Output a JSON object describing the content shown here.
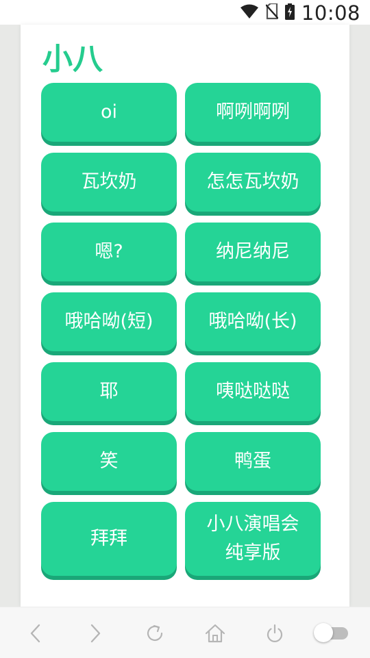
{
  "status_bar": {
    "time": "10:08",
    "icons": [
      "wifi-icon",
      "no-sim-icon",
      "battery-charging-icon"
    ]
  },
  "app": {
    "title": "小八"
  },
  "buttons": [
    {
      "label": "oi"
    },
    {
      "label": "啊咧啊咧"
    },
    {
      "label": "瓦坎奶"
    },
    {
      "label": "怎怎瓦坎奶"
    },
    {
      "label": "嗯?"
    },
    {
      "label": "纳尼纳尼"
    },
    {
      "label": "哦哈呦(短)"
    },
    {
      "label": "哦哈呦(长)"
    },
    {
      "label": "耶"
    },
    {
      "label": "咦哒哒哒"
    },
    {
      "label": "笑"
    },
    {
      "label": "鸭蛋"
    },
    {
      "label": "拜拜"
    },
    {
      "label": "小八演唱会\n纯享版"
    }
  ],
  "nav_bar": {
    "items": [
      "back-icon",
      "forward-icon",
      "refresh-icon",
      "home-icon",
      "power-icon"
    ],
    "toggle_state": "off"
  },
  "colors": {
    "accent": "#25cc8e",
    "button": "#25d496",
    "button_shadow": "#1aa778",
    "backdrop": "#e8e9e7"
  }
}
